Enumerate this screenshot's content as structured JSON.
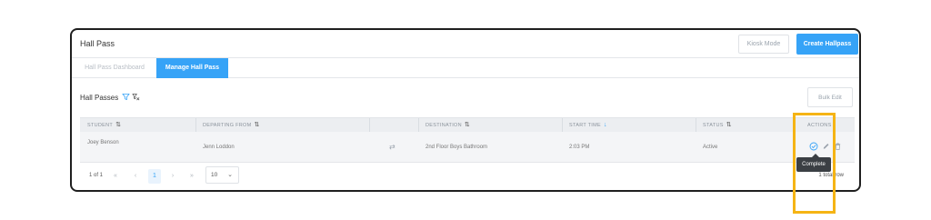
{
  "app": {
    "title": "Hall Pass"
  },
  "header": {
    "kiosk_label": "Kiosk Mode",
    "create_label": "Create Hallpass"
  },
  "tabs": [
    {
      "label": "Hall Pass Dashboard",
      "active": false
    },
    {
      "label": "Manage Hall Pass",
      "active": true
    }
  ],
  "section": {
    "title": "Hall Passes",
    "bulk_edit_label": "Bulk Edit"
  },
  "table": {
    "columns": [
      "STUDENT",
      "DEPARTING FROM",
      "",
      "DESTINATION",
      "START TIME",
      "STATUS",
      "ACTIONS"
    ],
    "rows": [
      {
        "student": "Joey Benson",
        "student_sub": "",
        "departing_from": "Jenn Loddon",
        "destination": "2nd Floor Boys Bathroom",
        "start_time": "2:03 PM",
        "status": "Active"
      }
    ]
  },
  "pagination": {
    "info": "1 of 1",
    "first": "«",
    "prev": "‹",
    "current": "1",
    "next": "›",
    "last": "»",
    "page_size": "10",
    "count": "1 total row"
  },
  "tooltip": {
    "text": "Complete"
  },
  "icons": {
    "filter": "filter-icon",
    "clear_filter": "clear-filter-icon",
    "swap": "swap-icon",
    "complete": "check-circle-icon",
    "edit": "pencil-icon",
    "delete": "trash-icon",
    "sort": "sort-icon"
  },
  "colors": {
    "accent": "#36a3f7",
    "highlight": "#f5b415",
    "tooltip_bg": "#3b3f44",
    "header_bg": "#eceef1"
  }
}
